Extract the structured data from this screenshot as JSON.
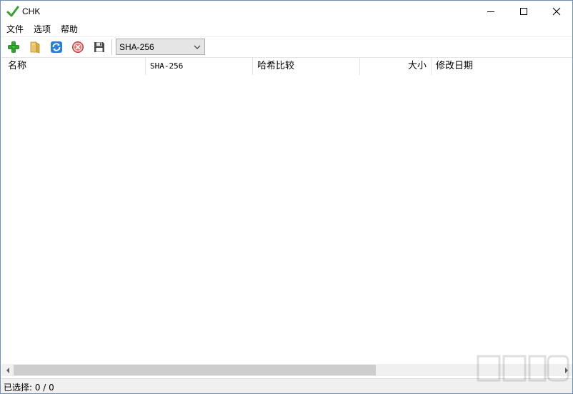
{
  "window": {
    "title": "CHK"
  },
  "controls": {
    "minimize": "minimize",
    "maximize": "maximize",
    "close": "close"
  },
  "menu": [
    {
      "label": "文件"
    },
    {
      "label": "选项"
    },
    {
      "label": "帮助"
    }
  ],
  "toolbar": {
    "buttons": [
      {
        "icon": "add-icon"
      },
      {
        "icon": "open-folder-icon"
      },
      {
        "icon": "refresh-icon"
      },
      {
        "icon": "stop-icon"
      },
      {
        "icon": "save-icon"
      }
    ],
    "hash_algorithm": "SHA-256"
  },
  "columns": {
    "name": "名称",
    "hash": "SHA-256",
    "compare": "哈希比较",
    "size": "大小",
    "modified": "修改日期"
  },
  "rows": [],
  "status": {
    "text": "已选择: 0 / 0"
  },
  "colors": {
    "check_green": "#3aa12f",
    "add_green": "#2fa32b",
    "refresh_blue": "#2a7fd4",
    "stop_red": "#d9534f",
    "border_blue": "#6f8fb5"
  }
}
